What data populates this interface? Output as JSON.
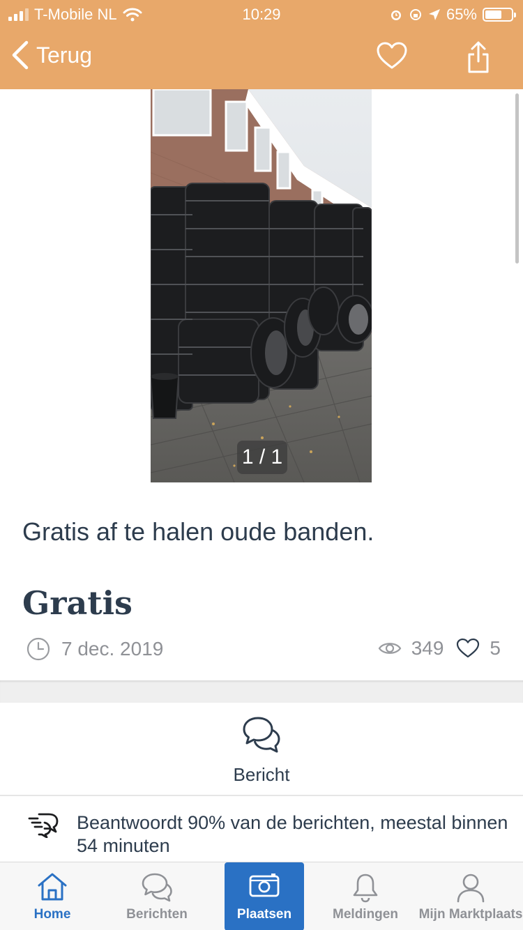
{
  "status": {
    "carrier": "T-Mobile NL",
    "time": "10:29",
    "battery": "65%",
    "battery_level": 0.65
  },
  "nav": {
    "back_label": "Terug"
  },
  "listing": {
    "image_counter": "1 / 1",
    "title": "Gratis af te halen oude banden.",
    "price": "Gratis",
    "date": "7 dec. 2019",
    "views": "349",
    "favorites": "5"
  },
  "actions": {
    "message_label": "Bericht"
  },
  "seller": {
    "reply_info": "Beantwoordt 90% van de berichten, meestal binnen 54 minuten"
  },
  "tabs": [
    {
      "label": "Home",
      "icon": "home-icon",
      "state": "active"
    },
    {
      "label": "Berichten",
      "icon": "chat-icon"
    },
    {
      "label": "Plaatsen",
      "icon": "camera-icon"
    },
    {
      "label": "Meldingen",
      "icon": "bell-icon"
    },
    {
      "label": "Mijn Marktplaats",
      "icon": "user-icon"
    }
  ],
  "colors": {
    "brand_orange": "#e8a86a",
    "accent_blue": "#2a71c4",
    "text_dark": "#2d3c4d",
    "text_muted": "#8f9196"
  }
}
